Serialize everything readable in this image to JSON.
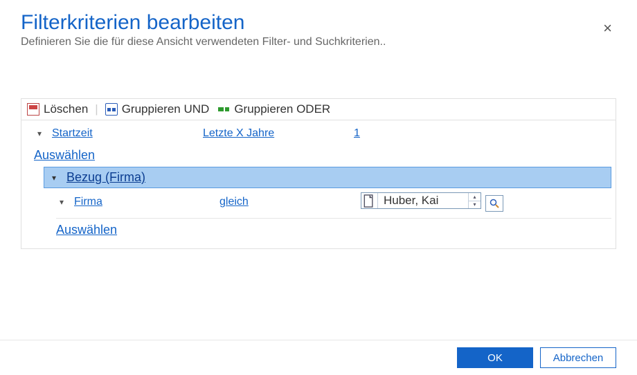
{
  "dialog": {
    "title": "Filterkriterien bearbeiten",
    "subtitle": "Definieren Sie die für diese Ansicht verwendeten Filter- und Suchkriterien..",
    "close": "×"
  },
  "toolbar": {
    "delete": "Löschen",
    "group_and": "Gruppieren UND",
    "group_or": "Gruppieren ODER"
  },
  "rows": {
    "row1": {
      "field": "Startzeit",
      "op": "Letzte X Jahre",
      "val": "1"
    },
    "select1": "Auswählen",
    "group": {
      "label": "Bezug (Firma)"
    },
    "row2": {
      "field": "Firma",
      "op": "gleich",
      "val": "Huber, Kai"
    },
    "select2": "Auswählen"
  },
  "footer": {
    "ok": "OK",
    "cancel": "Abbrechen"
  }
}
